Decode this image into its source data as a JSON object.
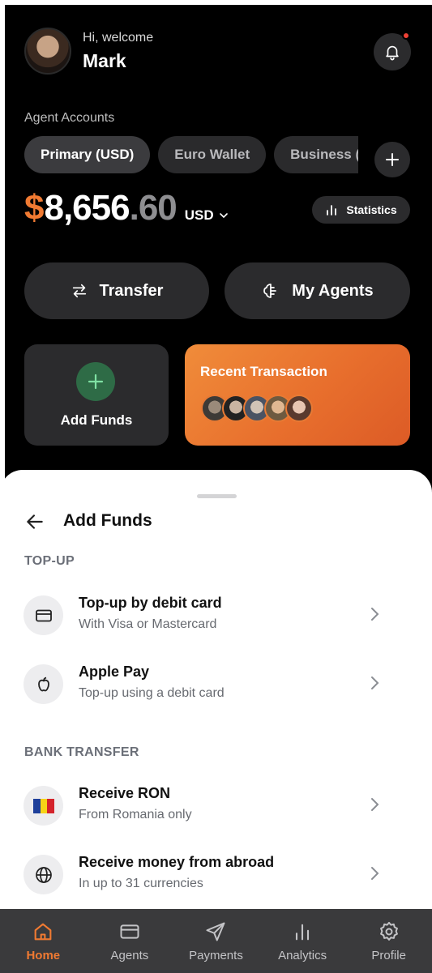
{
  "header": {
    "greeting": "Hi, welcome",
    "username": "Mark"
  },
  "accounts": {
    "label": "Agent Accounts",
    "tabs": [
      "Primary (USD)",
      "Euro Wallet",
      "Business (F"
    ],
    "active_index": 0
  },
  "balance": {
    "sign": "$",
    "whole": "8,656",
    "decimal": ".60",
    "currency": "USD"
  },
  "stats_label": "Statistics",
  "actions": {
    "transfer": "Transfer",
    "agents": "My Agents"
  },
  "cards": {
    "add_funds": "Add Funds",
    "recent": "Recent Transaction"
  },
  "sheet": {
    "title": "Add Funds",
    "groups": [
      {
        "label": "TOP-UP",
        "items": [
          {
            "title": "Top-up by debit card",
            "subtitle": "With Visa or Mastercard",
            "icon": "card-icon"
          },
          {
            "title": "Apple Pay",
            "subtitle": "Top-up using a debit card",
            "icon": "apple-icon"
          }
        ]
      },
      {
        "label": "BANK TRANSFER",
        "items": [
          {
            "title": "Receive RON",
            "subtitle": "From Romania only",
            "icon": "romania-flag-icon"
          },
          {
            "title": "Receive money from abroad",
            "subtitle": "In up to 31 currencies",
            "icon": "globe-icon"
          }
        ]
      }
    ]
  },
  "tabbar": [
    {
      "label": "Home",
      "icon": "home-icon",
      "active": true
    },
    {
      "label": "Agents",
      "icon": "card-icon"
    },
    {
      "label": "Payments",
      "icon": "send-icon"
    },
    {
      "label": "Analytics",
      "icon": "bar-chart-icon"
    },
    {
      "label": "Profile",
      "icon": "gear-icon"
    }
  ],
  "colors": {
    "accent": "#f07a32",
    "success": "#2e6b46",
    "alert": "#ef4135"
  }
}
